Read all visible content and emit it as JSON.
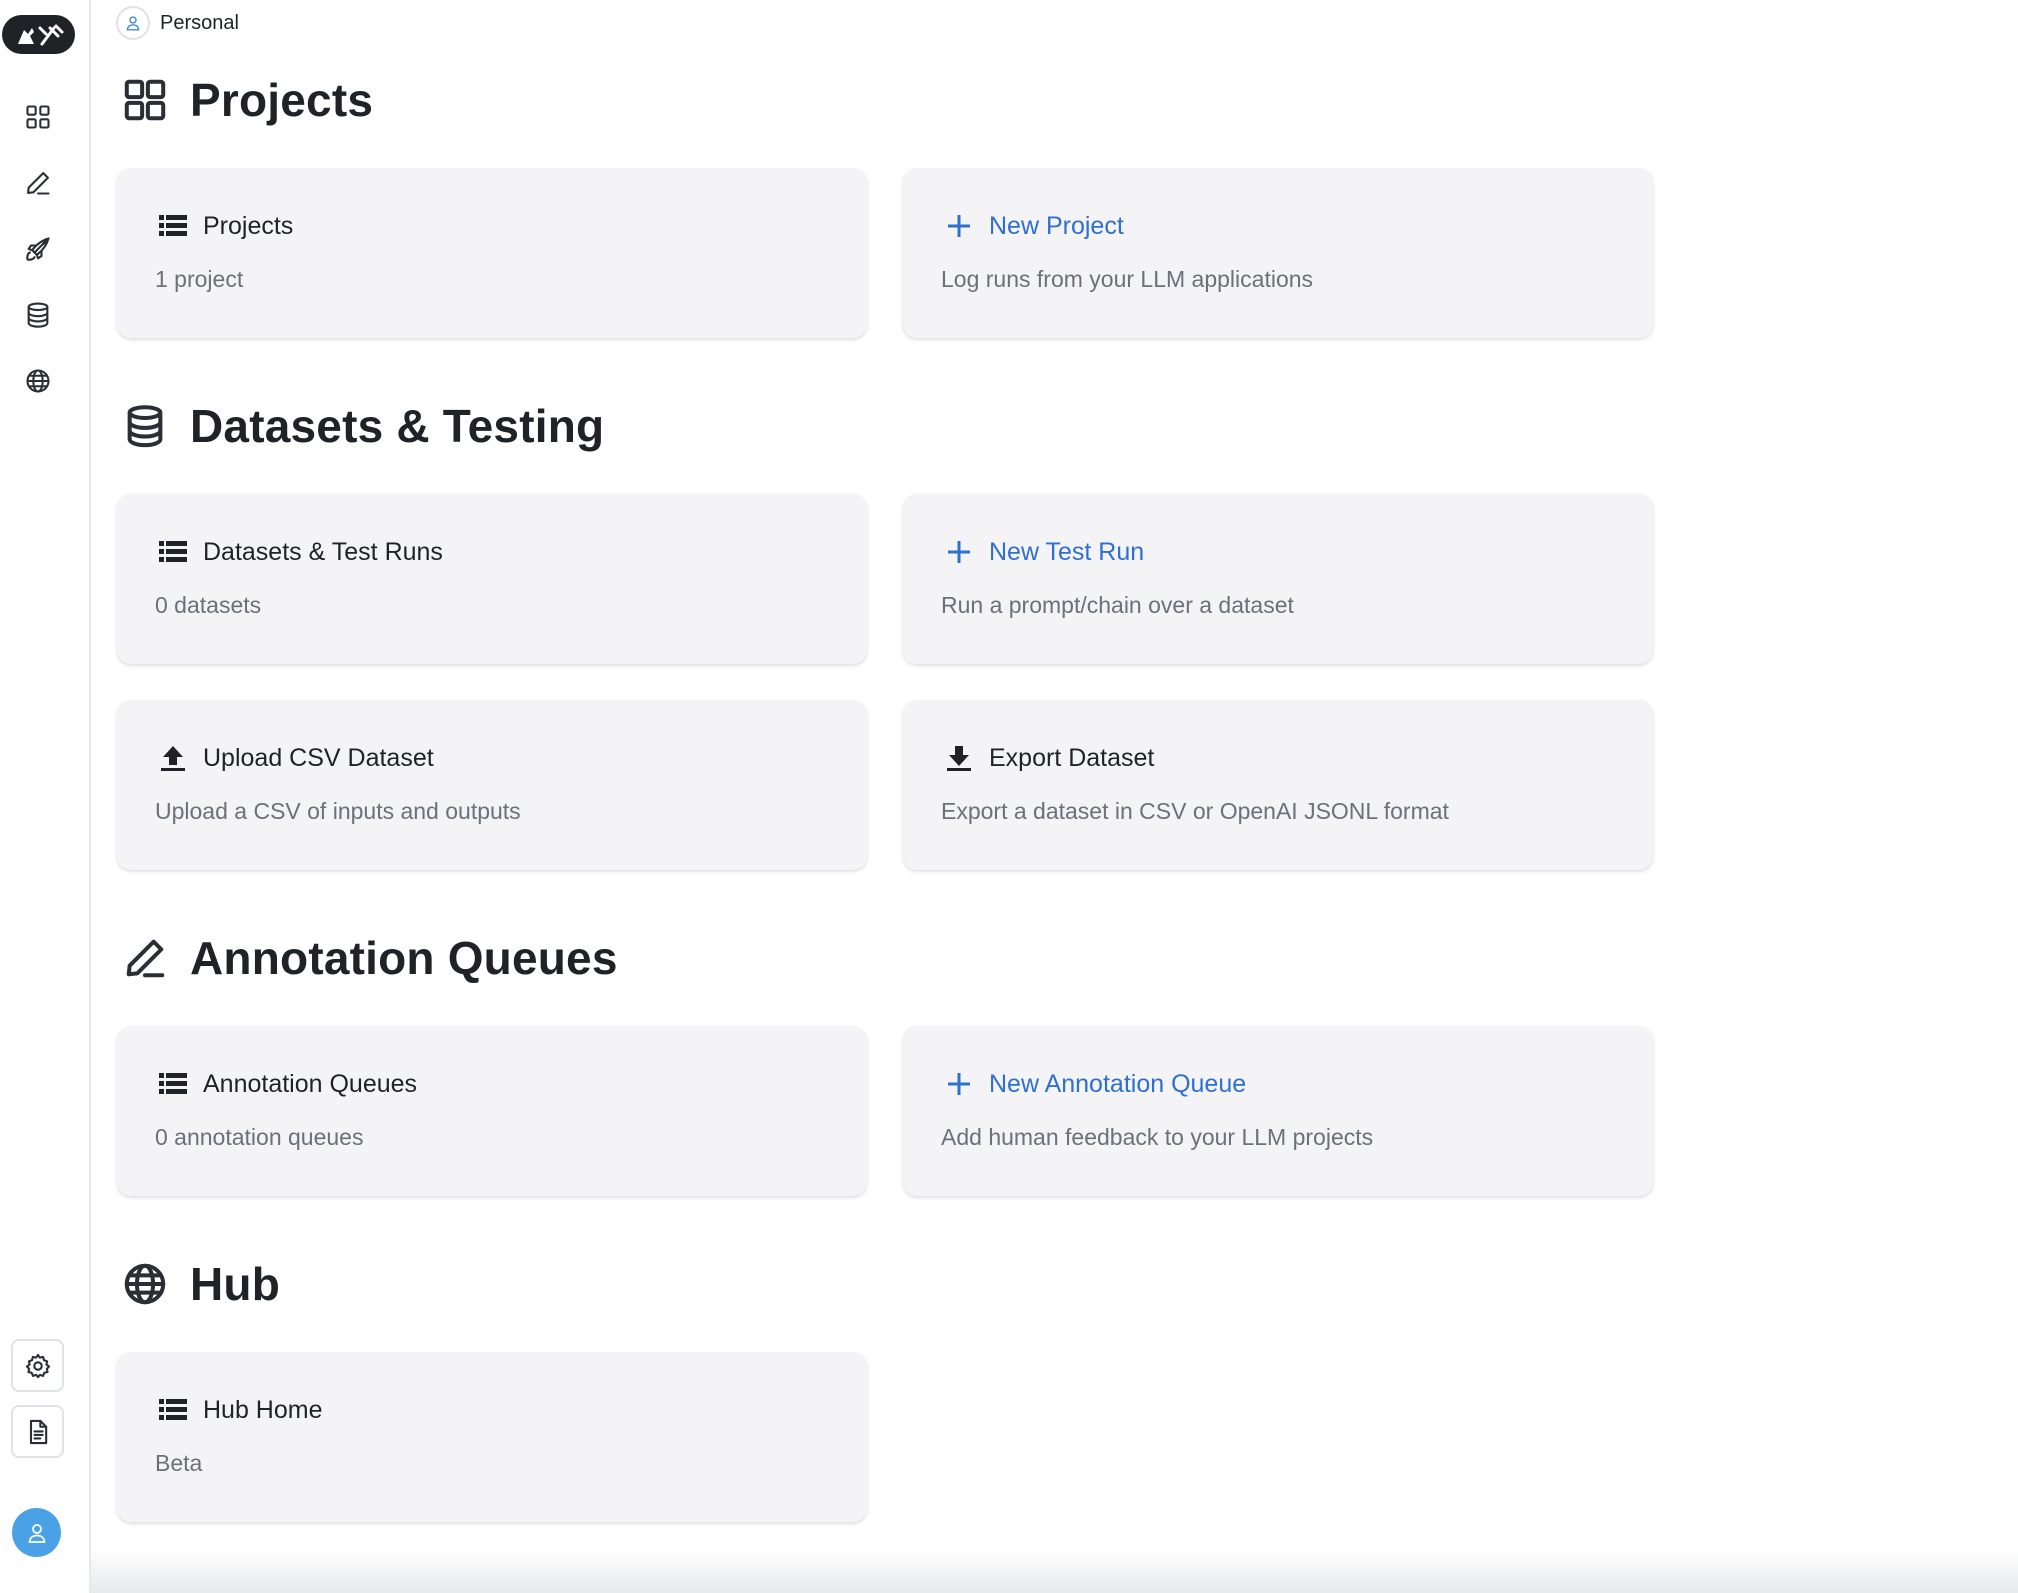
{
  "org": {
    "label": "Personal"
  },
  "sidebar": {
    "nav": [
      {
        "name": "projects-nav",
        "icon": "grid-icon"
      },
      {
        "name": "annotation-nav",
        "icon": "pen-icon"
      },
      {
        "name": "deployments-nav",
        "icon": "rocket-icon"
      },
      {
        "name": "datasets-nav",
        "icon": "database-icon"
      },
      {
        "name": "hub-nav",
        "icon": "globe-icon"
      }
    ],
    "footer": [
      {
        "name": "settings-button",
        "icon": "gear-icon"
      },
      {
        "name": "docs-button",
        "icon": "document-icon"
      }
    ]
  },
  "sections": {
    "projects": {
      "title": "Projects",
      "cards": {
        "list": {
          "title": "Projects",
          "subtitle": "1 project"
        },
        "new": {
          "title": "New Project",
          "subtitle": "Log runs from your LLM applications"
        }
      }
    },
    "datasets": {
      "title": "Datasets & Testing",
      "cards": {
        "list": {
          "title": "Datasets & Test Runs",
          "subtitle": "0 datasets"
        },
        "new": {
          "title": "New Test Run",
          "subtitle": "Run a prompt/chain over a dataset"
        },
        "upload": {
          "title": "Upload CSV Dataset",
          "subtitle": "Upload a CSV of inputs and outputs"
        },
        "export": {
          "title": "Export Dataset",
          "subtitle": "Export a dataset in CSV or OpenAI JSONL format"
        }
      }
    },
    "annotation": {
      "title": "Annotation Queues",
      "cards": {
        "list": {
          "title": "Annotation Queues",
          "subtitle": "0 annotation queues"
        },
        "new": {
          "title": "New Annotation Queue",
          "subtitle": "Add human feedback to your LLM projects"
        }
      }
    },
    "hub": {
      "title": "Hub",
      "cards": {
        "home": {
          "title": "Hub Home",
          "subtitle": "Beta"
        }
      }
    }
  },
  "colors": {
    "accent": "#2f6fd0",
    "card_bg": "#f4f4f6",
    "muted_text": "#6b7079",
    "avatar": "#4aa1e6"
  }
}
